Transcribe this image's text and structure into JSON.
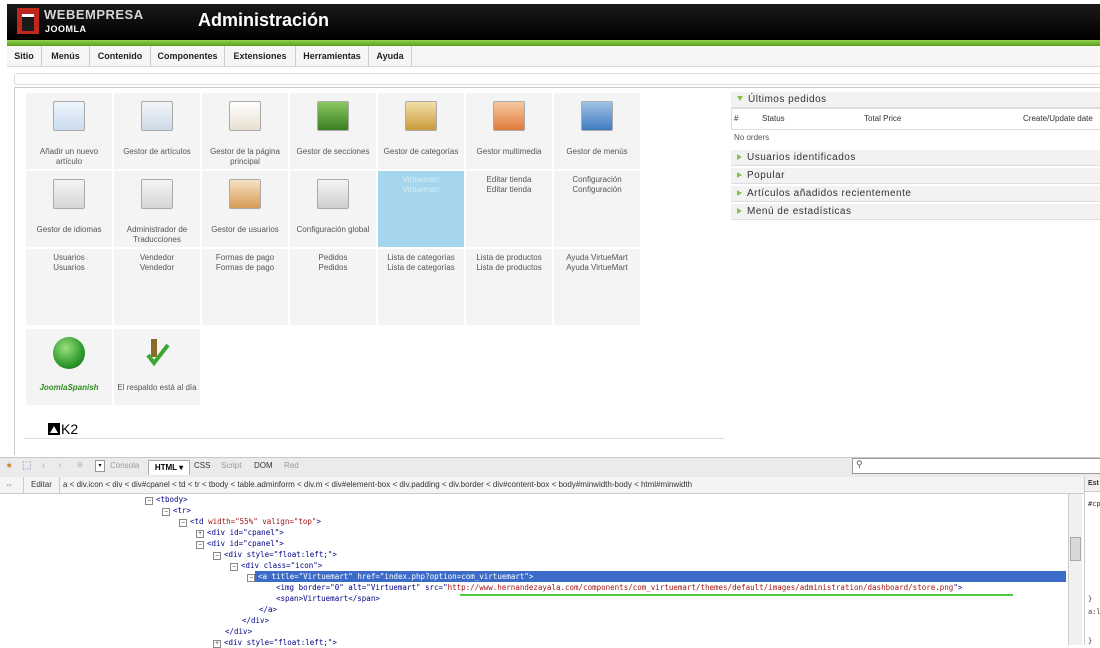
{
  "header": {
    "brand_line1": "WEBEMPRESA",
    "brand_line2": "JOOMLA",
    "title": "Administración"
  },
  "menu": [
    "Sitio",
    "Menús",
    "Contenido",
    "Componentes",
    "Extensiones",
    "Herramientas",
    "Ayuda"
  ],
  "cpanel": {
    "row1": [
      {
        "label": "Añadir un nuevo artículo",
        "icon": "add-article-icon"
      },
      {
        "label": "Gestor de artículos",
        "icon": "article-manager-icon"
      },
      {
        "label": "Gestor de la página principal",
        "icon": "frontpage-manager-icon"
      },
      {
        "label": "Gestor de secciones",
        "icon": "section-manager-icon"
      },
      {
        "label": "Gestor de categorías",
        "icon": "category-manager-icon"
      },
      {
        "label": "Gestor multimedia",
        "icon": "media-manager-icon"
      },
      {
        "label": "Gestor de menús",
        "icon": "menu-manager-icon"
      }
    ],
    "row2": [
      {
        "label": "Gestor de idiomas",
        "icon": "language-manager-icon"
      },
      {
        "label": "Administrador de Traducciones",
        "icon": "translation-manager-icon"
      },
      {
        "label": "Gestor de usuarios",
        "icon": "user-manager-icon"
      },
      {
        "label": "Configuración global",
        "icon": "global-config-icon"
      },
      {
        "label": "Virtuemart",
        "label2": "Virtuemart"
      },
      {
        "label": "Editar tienda",
        "label2": "Editar tienda"
      },
      {
        "label": "Configuración",
        "label2": "Configuración"
      }
    ],
    "row3": [
      {
        "label": "Usuarios",
        "label2": "Usuarios"
      },
      {
        "label": "Vendedor",
        "label2": "Vendedor"
      },
      {
        "label": "Formas de pago",
        "label2": "Formas de pago"
      },
      {
        "label": "Pedidos",
        "label2": "Pedidos"
      },
      {
        "label": "Lista de categorías",
        "label2": "Lista de categorías"
      },
      {
        "label": "Lista de productos",
        "label2": "Lista de productos"
      },
      {
        "label": "Ayuda VirtueMart",
        "label2": "Ayuda VirtueMart"
      }
    ],
    "row4": [
      {
        "label": "JoomlaSpanish",
        "icon": "globe-icon"
      },
      {
        "label": "El respaldo está al día",
        "icon": "backup-check-icon"
      }
    ],
    "k2_label": "K2"
  },
  "panels": {
    "orders_title": "Últimos pedidos",
    "orders_cols": [
      "#",
      "Status",
      "Total Price",
      "Create/Update date"
    ],
    "no_orders": "No orders",
    "logged_users": "Usuarios identificados",
    "popular": "Popular",
    "recent": "Artículos añadidos recientemente",
    "stats": "Menú de estadísticas"
  },
  "firebug": {
    "tabs": [
      "Consola",
      "HTML",
      "CSS",
      "Script",
      "DOM",
      "Red"
    ],
    "edit": "Editar",
    "breadcrumb": "a < div.icon < div < div#cpanel < td < tr < tbody < table.adminform < div.m < div#element-box < div.padding < div.border < div#content-box < body#minwidth-body < html#minwidth",
    "side_label": "Est",
    "side_code1": "#cp",
    "side_code2": "}",
    "side_code3": "a:l",
    "side_code4": "}",
    "code": {
      "l1": "<tbody>",
      "l2": "<tr>",
      "l3a": "<td ",
      "l3b": "width=\"55%\" valign=\"top\"",
      "l3c": ">",
      "l4": "<div id=\"cpanel\">",
      "l5": "<div id=\"cpanel\">",
      "l6": "<div style=\"float:left;\">",
      "l7": "<div class=\"icon\">",
      "l8": "<a title=\"Virtuemart\" href=\"index.php?option=com_virtuemart\">",
      "l9a": "<img border=\"0\" alt=\"Virtuemart\" src=\"",
      "l9b": "http://www.hernandezayala.com/components/com_virtuemart/themes/default/images/administration/dashboard/store.png",
      "l9c": "\">",
      "l10": "<span>Virtuemart</span>",
      "l11": "</a>",
      "l12": "</div>",
      "l13": "</div>",
      "l14": "<div style=\"float:left;\">"
    }
  }
}
